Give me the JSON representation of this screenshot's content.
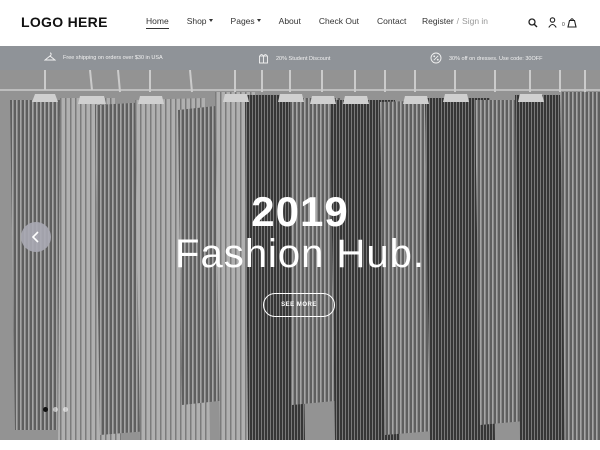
{
  "header": {
    "logo": "LOGO HERE",
    "nav": [
      {
        "label": "Home",
        "dropdown": false,
        "active": true
      },
      {
        "label": "Shop",
        "dropdown": true,
        "active": false
      },
      {
        "label": "Pages",
        "dropdown": true,
        "active": false
      },
      {
        "label": "About",
        "dropdown": false,
        "active": false
      },
      {
        "label": "Check Out",
        "dropdown": false,
        "active": false
      },
      {
        "label": "Contact",
        "dropdown": false,
        "active": false
      }
    ],
    "register_label": "Register",
    "separator": "/",
    "signin_label": "Sign in",
    "icons": [
      "search-icon",
      "user-icon",
      "cart-icon"
    ],
    "cart_count": "0"
  },
  "infobar": {
    "items": [
      {
        "icon": "shipping-icon",
        "text": "Free shipping on orders over $30 in USA"
      },
      {
        "icon": "gift-icon",
        "text": "20% Student Discount"
      },
      {
        "icon": "discount-icon",
        "text": "30% off on dresses. Use code: 30OFF"
      }
    ]
  },
  "hero": {
    "title": "2019",
    "subtitle": "Fashion Hub.",
    "button_label": "SEE MORE",
    "slide_count": 3,
    "active_slide": 1
  },
  "colors": {
    "infobar_bg": "#8f9398",
    "hero_text": "#ffffff",
    "arrow_bg": "#aaaab4"
  }
}
